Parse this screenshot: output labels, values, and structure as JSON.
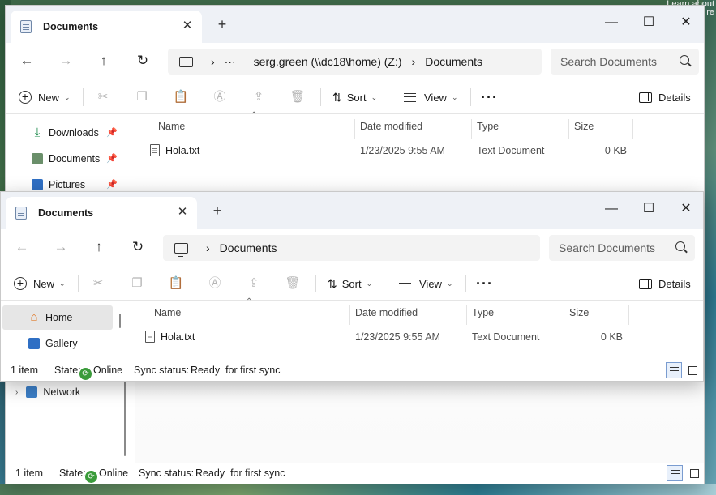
{
  "desktop": {
    "tooltip_text": "Learn about\nre"
  },
  "back_window": {
    "tab": {
      "title": "Documents"
    },
    "nav": {
      "address": {
        "more": "···",
        "path": [
          "serg.green (\\\\dc18\\home) (Z:)",
          "Documents"
        ]
      },
      "search_placeholder": "Search Documents"
    },
    "toolbar": {
      "new_label": "New",
      "sort_label": "Sort",
      "view_label": "View",
      "details_label": "Details"
    },
    "sidebar": {
      "items": [
        {
          "label": "Downloads",
          "icon": "download-icon",
          "pinned": true
        },
        {
          "label": "Documents",
          "icon": "documents-icon",
          "pinned": true
        },
        {
          "label": "Pictures",
          "icon": "pictures-icon",
          "pinned": true
        },
        {
          "label": "Network",
          "icon": "network-icon",
          "pinned": false
        }
      ]
    },
    "columns": [
      "Name",
      "Date modified",
      "Type",
      "Size"
    ],
    "files": [
      {
        "name": "Hola.txt",
        "date": "1/23/2025 9:55 AM",
        "type": "Text Document",
        "size": "0 KB"
      }
    ],
    "status": {
      "count": "1 item",
      "state_label": "State:",
      "state_value": "Online",
      "sync_label": "Sync status:",
      "sync_value": "Ready  for first sync"
    }
  },
  "front_window": {
    "tab": {
      "title": "Documents"
    },
    "nav": {
      "address": {
        "path": [
          "Documents"
        ]
      },
      "search_placeholder": "Search Documents"
    },
    "toolbar": {
      "new_label": "New",
      "sort_label": "Sort",
      "view_label": "View",
      "details_label": "Details"
    },
    "sidebar": {
      "items": [
        {
          "label": "Home",
          "icon": "home-icon",
          "selected": true
        },
        {
          "label": "Gallery",
          "icon": "gallery-icon",
          "selected": false
        }
      ]
    },
    "columns": [
      "Name",
      "Date modified",
      "Type",
      "Size"
    ],
    "files": [
      {
        "name": "Hola.txt",
        "date": "1/23/2025 9:55 AM",
        "type": "Text Document",
        "size": "0 KB"
      }
    ],
    "status": {
      "count": "1 item",
      "state_label": "State:",
      "state_value": "Online",
      "sync_label": "Sync status:",
      "sync_value": "Ready  for first sync"
    }
  },
  "colors": {
    "accent": "#0067c0",
    "titlebar": "#eef1f6",
    "selected": "#e6e6e6",
    "sync_green": "#3a9b3a"
  }
}
